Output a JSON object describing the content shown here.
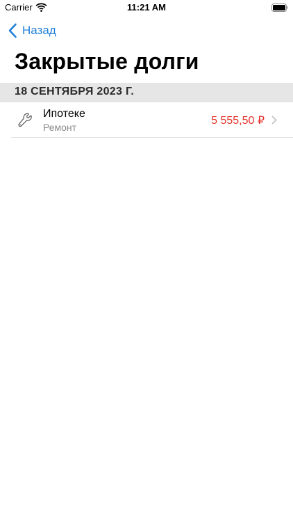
{
  "status_bar": {
    "carrier": "Carrier",
    "time": "11:21 AM",
    "wifi_icon": "wifi-icon",
    "battery_icon": "battery-full-icon"
  },
  "nav": {
    "back_label": "Назад",
    "back_icon": "chevron-left-icon",
    "accent_color": "#1f7fd8"
  },
  "page": {
    "title": "Закрытые долги"
  },
  "sections": [
    {
      "header": "18 СЕНТЯБРЯ 2023 Г.",
      "rows": [
        {
          "title": "Ипотеке",
          "subtitle": "Ремонт",
          "amount": "5 555,50 ₽",
          "amount_color": "#e5312b",
          "icon": "wrench-icon",
          "accessory_icon": "chevron-right-icon"
        }
      ]
    }
  ]
}
